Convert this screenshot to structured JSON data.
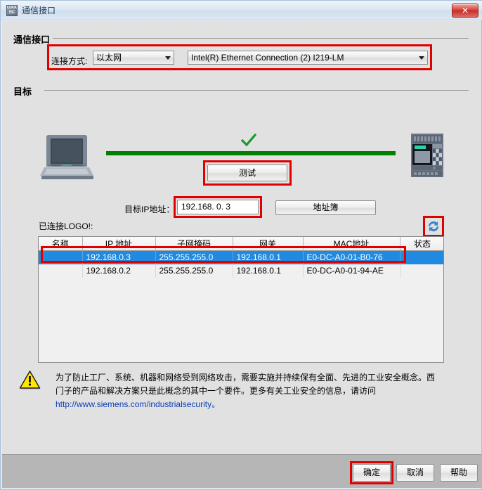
{
  "window": {
    "title": "通信接口",
    "icon": "logo-app-icon",
    "close_label": "✕"
  },
  "comm_group": {
    "legend": "通信接口",
    "connection_label": "连接方式:",
    "connection_value": "以太网",
    "adapter_value": "Intel(R) Ethernet Connection (2) I219-LM"
  },
  "target_group": {
    "legend": "目标",
    "test_button": "测试",
    "ip_label": "目标IP地址：",
    "ip_value": "192.168.  0.  3",
    "address_book_button": "地址簿",
    "connected_label": "已连接LOGO!:",
    "refresh_icon": "refresh-icon",
    "pc_icon": "computer-icon",
    "plc_icon": "logo-plc-icon",
    "status_icon": "green-check-icon",
    "link_color": "#008000"
  },
  "table": {
    "columns": [
      "名称",
      "IP 地址",
      "子网掩码",
      "网关",
      "MAC地址",
      "状态"
    ],
    "rows": [
      {
        "name": "",
        "ip": "192.168.0.3",
        "mask": "255.255.255.0",
        "gateway": "192.168.0.1",
        "mac": "E0-DC-A0-01-B0-76",
        "status": "",
        "selected": true
      },
      {
        "name": "",
        "ip": "192.168.0.2",
        "mask": "255.255.255.0",
        "gateway": "192.168.0.1",
        "mac": "E0-DC-A0-01-94-AE",
        "status": "",
        "selected": false
      }
    ],
    "selection_color": "#1f8ae0"
  },
  "warning": {
    "icon": "warning-triangle-icon",
    "line1": "为了防止工厂、系统、机器和网络受到网络攻击，需要实施并持续保有全面、先进的工业安全概念。西",
    "line2": "门子的产品和解决方案只是此概念的其中一个要件。更多有关工业安全的信息，请访问",
    "link": "http://www.siemens.com/industrialsecurity。"
  },
  "footer": {
    "ok_button": "确定",
    "cancel_button": "取消",
    "help_button": "帮助"
  },
  "annotations": {
    "highlight_color": "#e00000"
  }
}
